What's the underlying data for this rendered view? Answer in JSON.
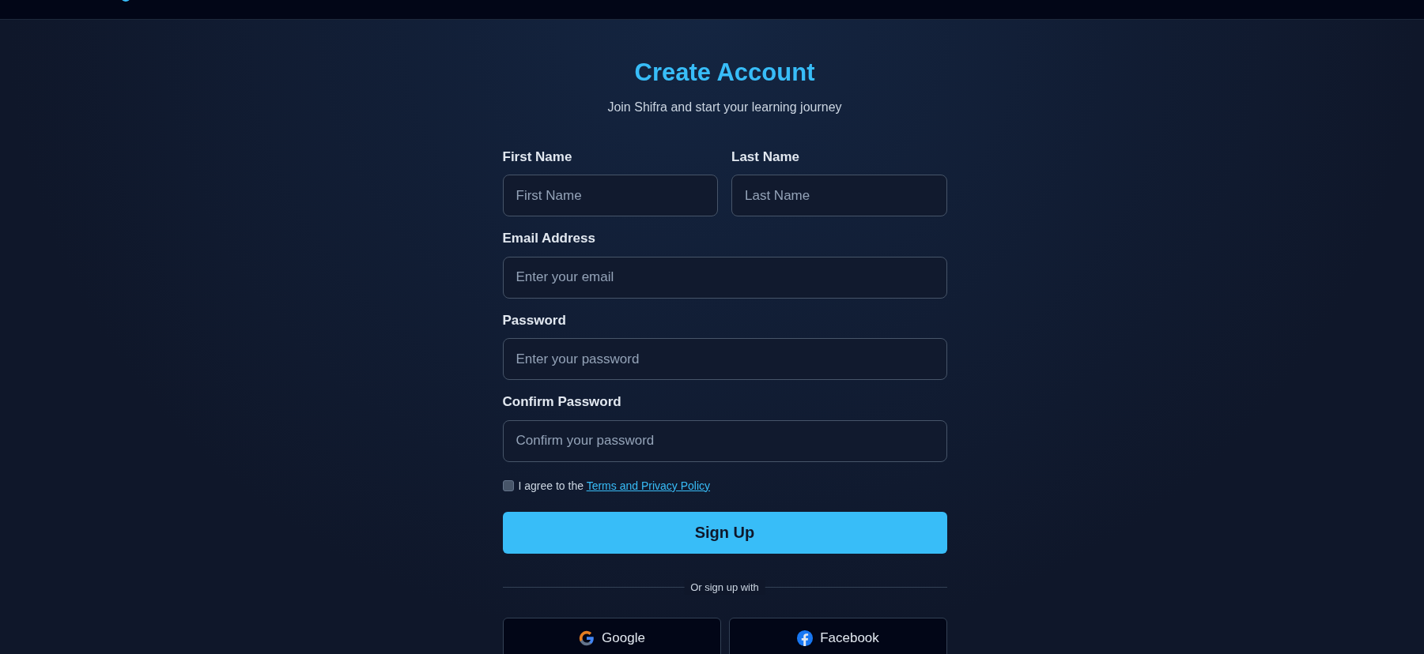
{
  "title": "Create Account",
  "subtitle": "Join Shifra and start your learning journey",
  "name_fields": [
    {
      "label": "First Name",
      "placeholder": "First Name"
    },
    {
      "label": "Last Name",
      "placeholder": "Last Name"
    }
  ],
  "fields": [
    {
      "label": "Email Address",
      "placeholder": "Enter your email"
    },
    {
      "label": "Password",
      "placeholder": "Enter your password"
    },
    {
      "label": "Confirm Password",
      "placeholder": "Confirm your password"
    }
  ],
  "agreement": {
    "checked": false,
    "text": "I agree to the",
    "link": "Terms and Privacy Policy"
  },
  "submit": "Sign Up",
  "divider_text": "Or sign up with",
  "social": [
    {
      "kind": "google",
      "label": "Google"
    },
    {
      "kind": "facebook",
      "label": "Facebook"
    }
  ]
}
